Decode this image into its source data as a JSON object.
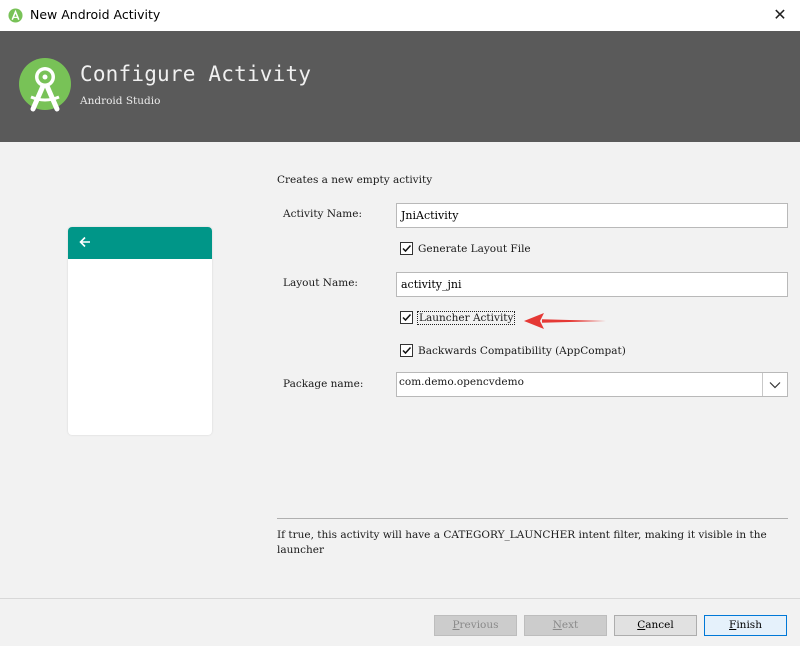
{
  "window": {
    "title": "New Android Activity",
    "close_glyph": "✕"
  },
  "header": {
    "title": "Configure Activity",
    "subtitle": "Android Studio",
    "logo_icon": "android-studio-icon"
  },
  "preview": {
    "appbar_color": "#009688",
    "back_icon": "arrow-left-icon"
  },
  "form": {
    "description": "Creates a new empty activity",
    "activity_name": {
      "label": "Activity Name:",
      "value": "JniActivity"
    },
    "generate_layout": {
      "label": "Generate Layout File",
      "checked": true
    },
    "layout_name": {
      "label": "Layout Name:",
      "value": "activity_jni"
    },
    "launcher_activity": {
      "label": "Launcher Activity",
      "checked": true
    },
    "backwards_compat": {
      "label": "Backwards Compatibility (AppCompat)",
      "checked": true
    },
    "package_name": {
      "label": "Package name:",
      "value": "com.demo.opencvdemo"
    }
  },
  "help": {
    "text": "If true, this activity will have a CATEGORY_LAUNCHER intent filter, making it visible in the launcher"
  },
  "buttons": {
    "previous": {
      "first": "P",
      "rest": "revious"
    },
    "next": {
      "first": "N",
      "rest": "ext"
    },
    "cancel": {
      "first": "C",
      "rest": "ancel"
    },
    "finish": {
      "first": "F",
      "rest": "inish"
    }
  },
  "colors": {
    "header_bg": "#5a5a5a",
    "accent": "#009688",
    "android_green": "#78c257",
    "annotation": "#e53935"
  }
}
